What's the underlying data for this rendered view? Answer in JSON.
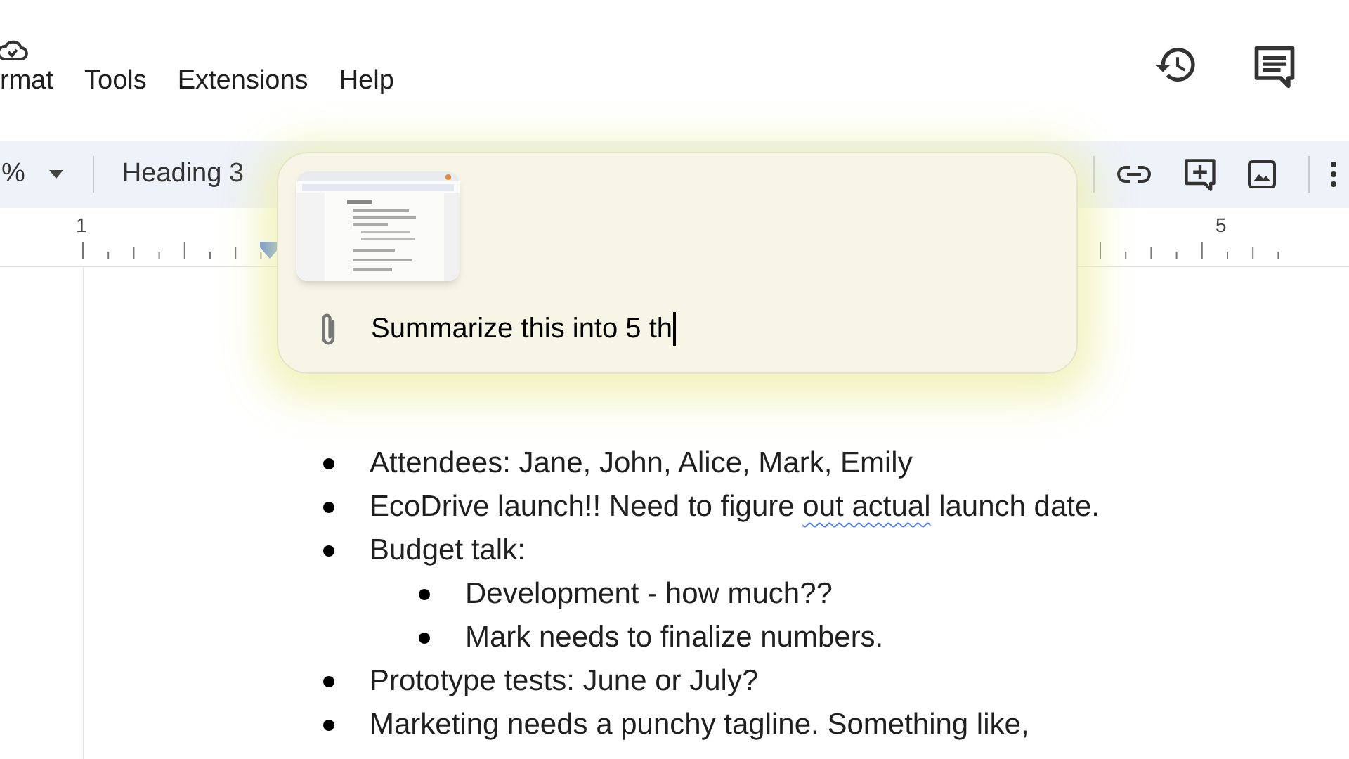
{
  "menu_bar": {
    "items": [
      "rmat",
      "Tools",
      "Extensions",
      "Help"
    ]
  },
  "toolbar": {
    "zoom": "%",
    "style": "Heading 3"
  },
  "ruler": {
    "marks": [
      "1",
      "5"
    ]
  },
  "document": {
    "bullets": [
      {
        "segments": [
          {
            "text": "Attendees: Jane, John, Alice, Mark, Emily",
            "flagged": false
          }
        ]
      },
      {
        "segments": [
          {
            "text": "EcoDrive launch!! Need to figure ",
            "flagged": false
          },
          {
            "text": "out actual",
            "flagged": true
          },
          {
            "text": " launch date.",
            "flagged": false
          }
        ]
      },
      {
        "segments": [
          {
            "text": "Budget talk:",
            "flagged": false
          }
        ],
        "children": [
          {
            "segments": [
              {
                "text": "Development - how much??",
                "flagged": false
              }
            ]
          },
          {
            "segments": [
              {
                "text": "Mark needs to finalize numbers.",
                "flagged": false
              }
            ]
          }
        ]
      },
      {
        "segments": [
          {
            "text": "Prototype tests: June or July?",
            "flagged": false
          }
        ]
      },
      {
        "segments": [
          {
            "text": "Marketing needs a punchy tagline. Something like,",
            "flagged": false
          }
        ]
      }
    ]
  },
  "prompt_popup": {
    "value": "Summarize this into 5 th"
  }
}
